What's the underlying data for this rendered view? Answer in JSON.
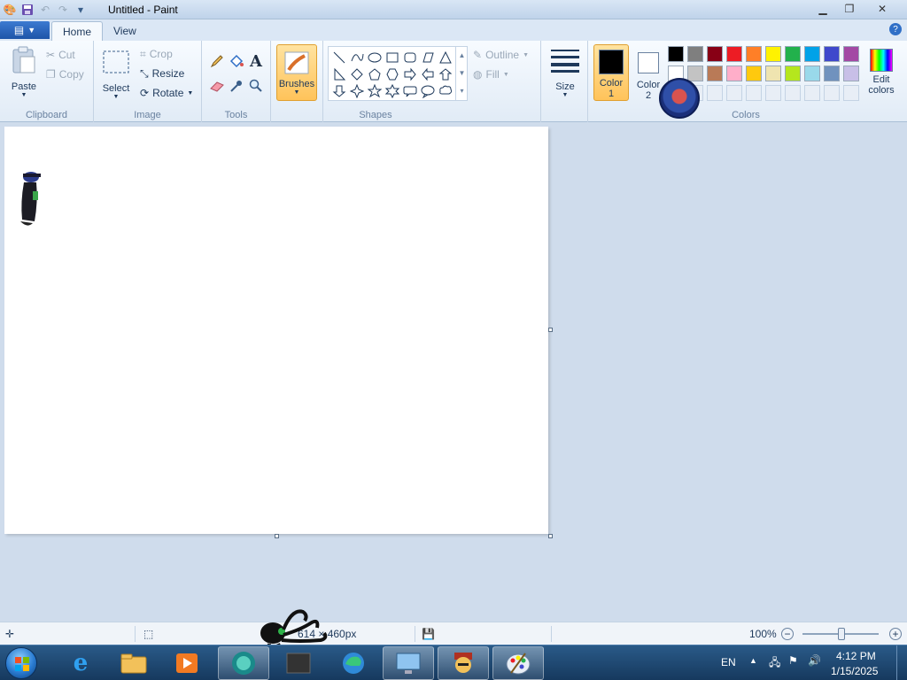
{
  "window": {
    "title": "Untitled - Paint"
  },
  "tabs": {
    "home": "Home",
    "view": "View"
  },
  "clipboard": {
    "paste": "Paste",
    "cut": "Cut",
    "copy": "Copy",
    "label": "Clipboard"
  },
  "image": {
    "select": "Select",
    "crop": "Crop",
    "resize": "Resize",
    "rotate": "Rotate",
    "label": "Image"
  },
  "tools": {
    "label": "Tools",
    "text_glyph": "A"
  },
  "brushes": {
    "label": "Brushes"
  },
  "shapes": {
    "outline": "Outline",
    "fill": "Fill",
    "label": "Shapes"
  },
  "size": {
    "label": "Size"
  },
  "colors": {
    "color1": "Color 1",
    "color2": "Color 2",
    "edit": "Edit colors",
    "label": "Colors",
    "color1_value": "#000000",
    "color2_value": "#ffffff",
    "palette_row1": [
      "#000000",
      "#7f7f7f",
      "#880015",
      "#ed1c24",
      "#ff7f27",
      "#fff200",
      "#22b14c",
      "#00a2e8",
      "#3f48cc",
      "#a349a4"
    ],
    "palette_row2": [
      "#ffffff",
      "#c3c3c3",
      "#b97a57",
      "#ffaec9",
      "#ffc90e",
      "#efe4b0",
      "#b5e61d",
      "#99d9ea",
      "#7092be",
      "#c8bfe7"
    ]
  },
  "status": {
    "dimensions": "614 × 460px",
    "zoom": "100%"
  },
  "tray": {
    "lang": "EN",
    "time": "4:12 PM",
    "date": "1/15/2025"
  }
}
